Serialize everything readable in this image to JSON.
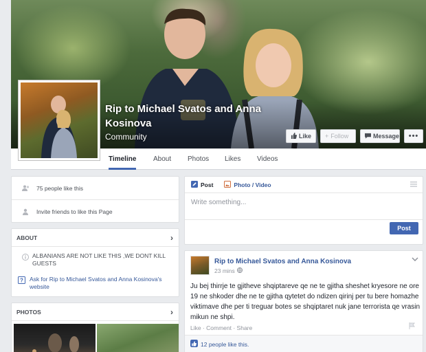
{
  "page": {
    "name": "Rip to Michael Svatos and Anna Kosinova",
    "category": "Community"
  },
  "cover_buttons": {
    "like": "Like",
    "follow": "Follow",
    "message": "Message",
    "more": "•••"
  },
  "tabs": [
    {
      "label": "Timeline",
      "active": true
    },
    {
      "label": "About",
      "active": false
    },
    {
      "label": "Photos",
      "active": false
    },
    {
      "label": "Likes",
      "active": false
    },
    {
      "label": "Videos",
      "active": false
    }
  ],
  "left": {
    "likes_count": "75 people like this",
    "invite": "Invite friends to like this Page",
    "about_title": "ABOUT",
    "about_text": "ALBANIANS ARE NOT LIKE THIS ,WE DONT KILL GUESTS",
    "website_link": "Ask for Rip to Michael Svatos and Anna Kosinova's website",
    "photos_title": "PHOTOS"
  },
  "composer": {
    "post_tab": "Post",
    "photo_tab": "Photo / Video",
    "placeholder": "Write something...",
    "post_button": "Post"
  },
  "feed_post": {
    "author": "Rip to Michael Svatos and Anna Kosinova",
    "time": "23 mins",
    "text": "Ju bej thirrje te gjitheve shqiptareve qe ne te gjitha sheshet kryesore ne ore 19 ne shkoder dhe ne te gjitha qytetet do ndizen qirinj per tu bere homazhe viktimave dhe per ti treguar botes se shqiptaret nuk jane terrorista qe vrasin mikun ne shpi.",
    "actions": "Like · Comment · Share",
    "likes": "12 people like this."
  },
  "colors": {
    "brand_blue": "#4267b2",
    "link_blue": "#365899",
    "background": "#e9ebee"
  },
  "icons": [
    "like-icon",
    "person-add-icon",
    "info-icon",
    "globe-link-icon",
    "chevron-right-icon",
    "pencil-icon",
    "photo-icon",
    "chevron-down-icon",
    "thumbs-up-icon",
    "flag-icon"
  ]
}
